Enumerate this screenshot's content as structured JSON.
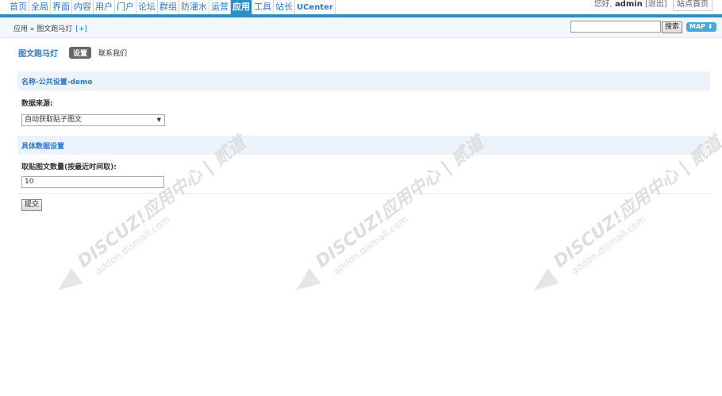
{
  "topnav": {
    "items": [
      "首页",
      "全局",
      "界面",
      "内容",
      "用户",
      "门户",
      "论坛",
      "群组",
      "防灌水",
      "运营",
      "应用",
      "工具",
      "站长",
      "UCenter"
    ],
    "active_index": 10,
    "greeting": "您好,",
    "username": "admin",
    "logout": "[退出]",
    "site_home": "站点首页"
  },
  "breadcrumb": {
    "text": "应用 » 图文跑马灯",
    "plus": "[+]"
  },
  "search": {
    "value": "",
    "button": "搜索",
    "map": "MAP ⬇"
  },
  "plugin": {
    "name": "图文跑马灯",
    "tab_active": "设置",
    "tab_contact": "联系我们"
  },
  "section1": {
    "title": "名称-公共设置-demo"
  },
  "source": {
    "label": "数据来源:",
    "value": "自动获取贴子图文"
  },
  "section2": {
    "title": "具体数据设置"
  },
  "count": {
    "label": "取贴图文数量(按最近时间取):",
    "value": "10"
  },
  "submit": "提交",
  "watermark": {
    "line1": "DISCUZ!应用中心 | 贰道",
    "line2": "addon.dismall.com"
  },
  "colors": {
    "accent": "#2e8fc3",
    "link": "#2b7acd",
    "section_bg": "#ecf3fa"
  }
}
